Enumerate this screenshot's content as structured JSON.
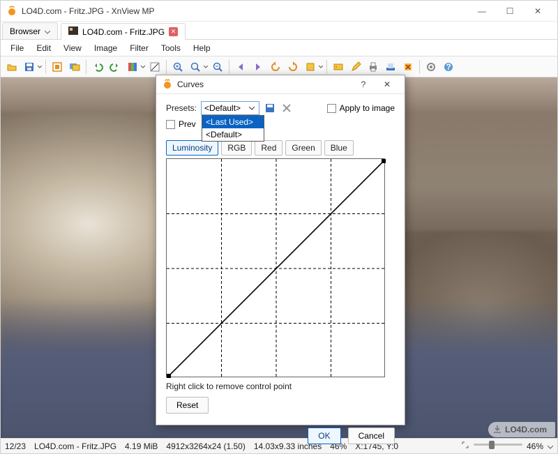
{
  "window": {
    "title": "LO4D.com - Fritz.JPG - XnView MP",
    "min": "—",
    "max": "☐",
    "close": "✕"
  },
  "tabs": {
    "browser": "Browser",
    "file": "LO4D.com - Fritz.JPG"
  },
  "menu": {
    "file": "File",
    "edit": "Edit",
    "view": "View",
    "image": "Image",
    "filter": "Filter",
    "tools": "Tools",
    "help": "Help"
  },
  "status": {
    "index": "12/23",
    "filename": "LO4D.com - Fritz.JPG",
    "filesize": "4.19 MiB",
    "dims": "4912x3264x24 (1.50)",
    "inches": "14.03x9.33 inches",
    "zoom": "46%",
    "coords": "X:1745, Y:0",
    "zoom2": "46%"
  },
  "overlay": {
    "brand": "LO4D.com"
  },
  "dialog": {
    "title": "Curves",
    "help": "?",
    "close": "✕",
    "presets_label": "Presets:",
    "preset_selected": "<Default>",
    "preset_options": {
      "last": "<Last Used>",
      "def": "<Default>"
    },
    "preview_label": "Prev",
    "apply_label": "Apply to image",
    "channel_tabs": {
      "luminosity": "Luminosity",
      "rgb": "RGB",
      "red": "Red",
      "green": "Green",
      "blue": "Blue"
    },
    "hint": "Right click to remove control point",
    "reset": "Reset",
    "ok": "OK",
    "cancel": "Cancel"
  },
  "chart_data": {
    "type": "line",
    "title": "Curves",
    "xlabel": "",
    "ylabel": "",
    "xlim": [
      0,
      255
    ],
    "ylim": [
      0,
      255
    ],
    "grid": {
      "cols": 4,
      "rows": 4,
      "style": "dashed"
    },
    "series": [
      {
        "name": "Luminosity",
        "x": [
          0,
          255
        ],
        "y": [
          0,
          255
        ]
      }
    ]
  }
}
